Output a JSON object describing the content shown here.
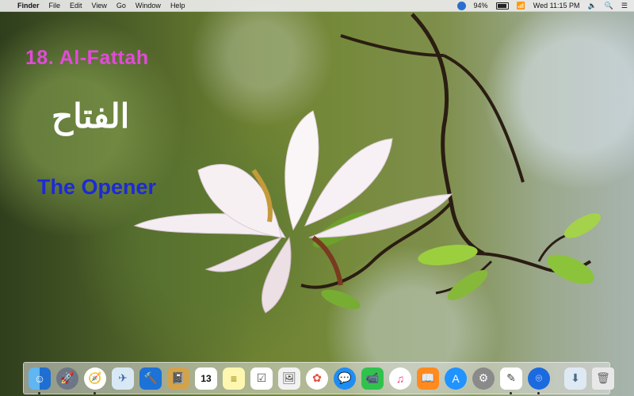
{
  "menubar": {
    "apple_icon": "apple-icon",
    "app_name": "Finder",
    "menus": [
      "File",
      "Edit",
      "View",
      "Go",
      "Window",
      "Help"
    ],
    "battery_percent": "94%",
    "datetime": "Wed 11:15 PM"
  },
  "overlay": {
    "title": "18. Al-Fattah",
    "arabic": "الفتاح",
    "meaning": "The Opener",
    "colors": {
      "title": "#e24ad9",
      "arabic": "#ffffff",
      "meaning": "#1c2ad6"
    }
  },
  "dock": {
    "icons": [
      "finder-icon",
      "launchpad-icon",
      "safari-icon",
      "preview-icon",
      "xcode-icon",
      "notebook-icon",
      "calendar-icon",
      "notes-icon",
      "reminders-icon",
      "photo-viewer-icon",
      "photos-icon",
      "messages-icon",
      "facetime-icon",
      "itunes-icon",
      "ibooks-icon",
      "app-store-icon",
      "system-preferences-icon",
      "textedit-icon",
      "blue-app-icon",
      "downloads-icon",
      "trash-icon"
    ],
    "calendar_day": "13"
  }
}
